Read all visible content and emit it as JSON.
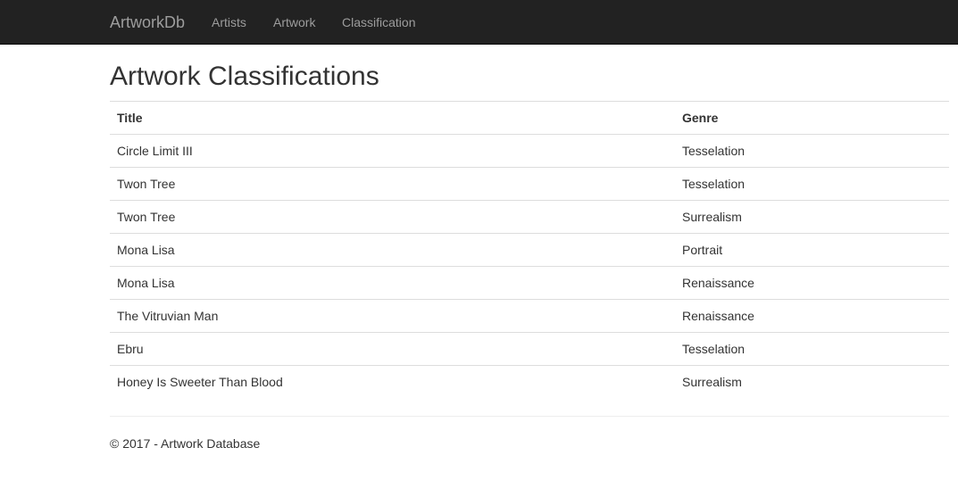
{
  "navbar": {
    "brand": "ArtworkDb",
    "items": [
      {
        "label": "Artists"
      },
      {
        "label": "Artwork"
      },
      {
        "label": "Classification"
      }
    ]
  },
  "page": {
    "title": "Artwork Classifications"
  },
  "table": {
    "headers": {
      "title": "Title",
      "genre": "Genre"
    },
    "rows": [
      {
        "title": "Circle Limit III",
        "genre": "Tesselation"
      },
      {
        "title": "Twon Tree",
        "genre": "Tesselation"
      },
      {
        "title": "Twon Tree",
        "genre": "Surrealism"
      },
      {
        "title": "Mona Lisa",
        "genre": "Portrait"
      },
      {
        "title": "Mona Lisa",
        "genre": "Renaissance"
      },
      {
        "title": "The Vitruvian Man",
        "genre": "Renaissance"
      },
      {
        "title": "Ebru",
        "genre": "Tesselation"
      },
      {
        "title": "Honey Is Sweeter Than Blood",
        "genre": "Surrealism"
      }
    ]
  },
  "footer": {
    "text": "© 2017 - Artwork Database"
  },
  "colors": {
    "navbar_bg": "#222222",
    "nav_text": "#9d9d9d",
    "body_text": "#333333",
    "row_border": "#dddddd"
  }
}
